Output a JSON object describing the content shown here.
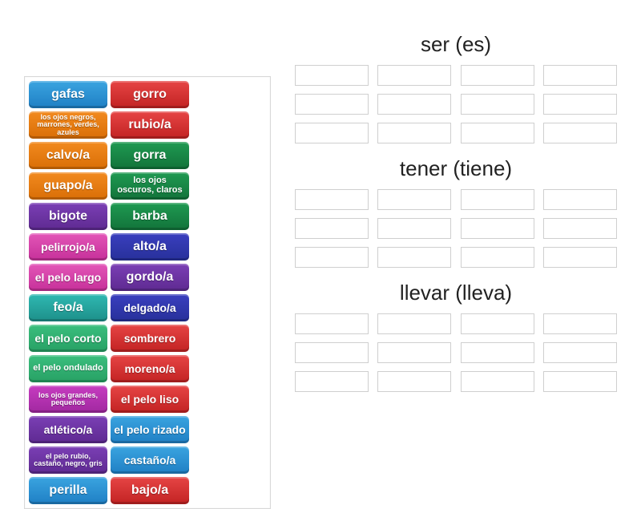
{
  "tiles": [
    {
      "label": "gafas",
      "color": "c-blue",
      "size": "fs-lg"
    },
    {
      "label": "gorro",
      "color": "c-red",
      "size": "fs-lg"
    },
    {
      "label": "los ojos negros, marrones, verdes, azules",
      "color": "c-orange",
      "size": "fs-xs"
    },
    {
      "label": "rubio/a",
      "color": "c-red",
      "size": "fs-lg"
    },
    {
      "label": "calvo/a",
      "color": "c-orange",
      "size": "fs-lg"
    },
    {
      "label": "gorra",
      "color": "c-green",
      "size": "fs-lg"
    },
    {
      "label": "guapo/a",
      "color": "c-orange",
      "size": "fs-lg"
    },
    {
      "label": "los ojos oscuros, claros",
      "color": "c-green",
      "size": "fs-sm"
    },
    {
      "label": "bigote",
      "color": "c-purple",
      "size": "fs-lg"
    },
    {
      "label": "barba",
      "color": "c-green",
      "size": "fs-lg"
    },
    {
      "label": "pelirrojo/a",
      "color": "c-pink",
      "size": "fs-md"
    },
    {
      "label": "alto/a",
      "color": "c-indigo",
      "size": "fs-lg"
    },
    {
      "label": "el pelo largo",
      "color": "c-pink",
      "size": "fs-md"
    },
    {
      "label": "gordo/a",
      "color": "c-purple",
      "size": "fs-lg"
    },
    {
      "label": "feo/a",
      "color": "c-teal",
      "size": "fs-lg"
    },
    {
      "label": "delgado/a",
      "color": "c-indigo",
      "size": "fs-md"
    },
    {
      "label": "el pelo corto",
      "color": "c-lgreen",
      "size": "fs-md"
    },
    {
      "label": "sombrero",
      "color": "c-red",
      "size": "fs-md"
    },
    {
      "label": "el pelo ondulado",
      "color": "c-lgreen",
      "size": "fs-sm"
    },
    {
      "label": "moreno/a",
      "color": "c-red",
      "size": "fs-md"
    },
    {
      "label": "los ojos grandes, pequeños",
      "color": "c-magenta",
      "size": "fs-xs"
    },
    {
      "label": "el pelo liso",
      "color": "c-red",
      "size": "fs-md"
    },
    {
      "label": "atlético/a",
      "color": "c-purple",
      "size": "fs-md"
    },
    {
      "label": "el pelo rizado",
      "color": "c-blue",
      "size": "fs-md"
    },
    {
      "label": "el pelo rubio, castaño, negro, gris",
      "color": "c-purple",
      "size": "fs-xs"
    },
    {
      "label": "castaño/a",
      "color": "c-blue",
      "size": "fs-md"
    },
    {
      "label": "perilla",
      "color": "c-blue",
      "size": "fs-lg"
    },
    {
      "label": "bajo/a",
      "color": "c-red",
      "size": "fs-lg"
    }
  ],
  "groups": [
    {
      "title": "ser (es)",
      "rows": 3,
      "cols": 4
    },
    {
      "title": "tener (tiene)",
      "rows": 3,
      "cols": 4
    },
    {
      "title": "llevar (lleva)",
      "rows": 3,
      "cols": 4
    }
  ]
}
